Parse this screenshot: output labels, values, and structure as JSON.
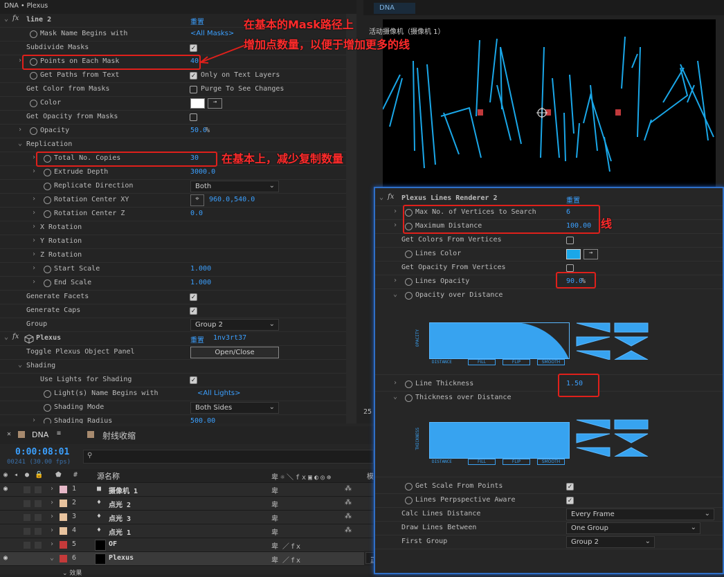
{
  "effects_panel": {
    "title": "DNA • Plexus",
    "line2": {
      "name": "line 2",
      "reset": "重置",
      "mask_name_begins_label": "Mask Name Begins with",
      "mask_name_begins_value": "<All Masks>",
      "subdivide_label": "Subdivide Masks",
      "points_label": "Points on Each Mask",
      "points_value": "40",
      "get_paths_label": "Get Paths from Text",
      "only_text_label": "Only on Text Layers",
      "get_color_label": "Get Color from Masks",
      "purge_label": "Purge To See Changes",
      "color_label": "Color",
      "get_opacity_label": "Get Opacity from Masks",
      "opacity_label": "Opacity",
      "opacity_value": "50.0",
      "opacity_unit": "%",
      "replication_label": "Replication",
      "total_copies_label": "Total No. Copies",
      "total_copies_value": "30",
      "extrude_label": "Extrude Depth",
      "extrude_value": "3000.0",
      "rep_dir_label": "Replicate Direction",
      "rep_dir_value": "Both",
      "rot_xy_label": "Rotation Center XY",
      "rot_xy_value": "960.0,540.0",
      "rot_z_label": "Rotation Center Z",
      "rot_z_value": "0.0",
      "x_rot_label": "X Rotation",
      "y_rot_label": "Y Rotation",
      "z_rot_label": "Z Rotation",
      "start_scale_label": "Start Scale",
      "start_scale_value": "1.000",
      "end_scale_label": "End Scale",
      "end_scale_value": "1.000",
      "facets_label": "Generate Facets",
      "caps_label": "Generate Caps",
      "group_label": "Group",
      "group_value": "Group 2"
    },
    "plexus": {
      "name": "Plexus",
      "reset": "重置",
      "code": "1nv3rt37",
      "toggle_label": "Toggle Plexus Object Panel",
      "toggle_btn": "Open/Close",
      "shading_label": "Shading",
      "use_lights_label": "Use Lights for Shading",
      "light_name_label": "Light(s) Name Begins with",
      "light_name_value": "<All Lights>",
      "shading_mode_label": "Shading Mode",
      "shading_mode_value": "Both Sides",
      "shading_radius_label": "Shading Radius",
      "shading_radius_value": "500.00"
    }
  },
  "annotations": {
    "mask_line1": "在基本的Mask路径上",
    "mask_line2": "增加点数量，以便于增加更多的线",
    "copies": "在基本上，减少复制数量",
    "lines": "线"
  },
  "viewer": {
    "tab": "DNA",
    "label": "活动摄像机（摄像机 1）",
    "zoom": "25"
  },
  "renderer": {
    "name": "Plexus Lines Renderer 2",
    "reset": "重置",
    "max_vertices_label": "Max No. of Vertices to Search",
    "max_vertices_value": "6",
    "max_distance_label": "Maximum Distance",
    "max_distance_value": "100.00",
    "colors_vertices_label": "Get Colors From Vertices",
    "lines_color_label": "Lines Color",
    "opacity_vertices_label": "Get Opacity From Vertices",
    "lines_opacity_label": "Lines Opacity",
    "lines_opacity_value": "90.0",
    "lines_opacity_unit": "%",
    "opacity_over_distance_label": "Opacity over Distance",
    "graph_y1": "OPACITY",
    "graph_distance": "DISTANCE",
    "graph_fill": "FILL",
    "graph_flip": "FLIP",
    "graph_smooth": "SMOOTH",
    "line_thickness_label": "Line Thickness",
    "line_thickness_value": "1.50",
    "thickness_over_distance_label": "Thickness over Distance",
    "graph_y2": "THICKNESS",
    "get_scale_label": "Get Scale From Points",
    "persp_label": "Lines Perpspective Aware",
    "calc_label": "Calc Lines Distance",
    "calc_value": "Every Frame",
    "draw_between_label": "Draw Lines Between",
    "draw_between_value": "One Group",
    "first_group_label": "First Group",
    "first_group_value": "Group 2"
  },
  "timeline": {
    "tab1": "DNA",
    "tab2": "射线收缩",
    "timecode": "0:00:08:01",
    "fps": "00241 (30.00 fps)",
    "col_hash": "#",
    "col_source": "源名称",
    "col_mode": "模",
    "layers": [
      {
        "num": "1",
        "name": "摄像机 1",
        "color": "#e6b8c8"
      },
      {
        "num": "2",
        "name": "点光 2",
        "color": "#e8c39e"
      },
      {
        "num": "3",
        "name": "点光 3",
        "color": "#e8c39e"
      },
      {
        "num": "4",
        "name": "点光 1",
        "color": "#e8c39e"
      },
      {
        "num": "5",
        "name": "OF",
        "color": "#c43a3a"
      },
      {
        "num": "6",
        "name": "Plexus",
        "color": "#c43a3a"
      }
    ],
    "effects_sub": "效果",
    "mode_value": "正常",
    "track_none1": "无",
    "track_none2": "无"
  },
  "colors": {
    "accent_blue": "#3ba0ff",
    "annotation_red": "#e0201b",
    "line_cyan": "#1aa7e8",
    "renderer_border": "#2f6fc7"
  }
}
